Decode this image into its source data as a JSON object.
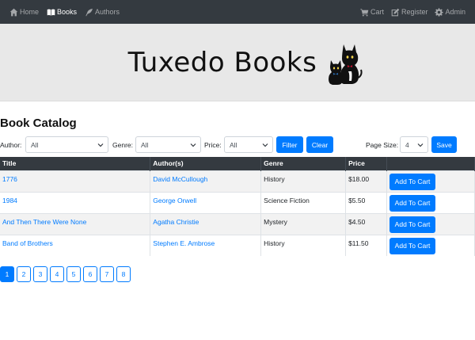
{
  "nav": {
    "left": [
      {
        "label": "Home",
        "icon": "home-icon"
      },
      {
        "label": "Books",
        "icon": "book-icon",
        "active": true
      },
      {
        "label": "Authors",
        "icon": "feather-icon"
      }
    ],
    "right": [
      {
        "label": "Cart",
        "icon": "cart-icon"
      },
      {
        "label": "Register",
        "icon": "edit-icon"
      },
      {
        "label": "Admin",
        "icon": "gear-icon"
      }
    ]
  },
  "banner": {
    "title": "Tuxedo Books"
  },
  "catalog": {
    "heading": "Book Catalog",
    "filters": {
      "author_label": "Author:",
      "author_value": "All",
      "genre_label": "Genre:",
      "genre_value": "All",
      "price_label": "Price:",
      "price_value": "All",
      "filter_button": "Filter",
      "clear_button": "Clear",
      "page_size_label": "Page Size:",
      "page_size_value": "4",
      "save_button": "Save"
    },
    "columns": [
      "Title",
      "Author(s)",
      "Genre",
      "Price",
      ""
    ],
    "rows": [
      {
        "title": "1776",
        "author": "David McCullough",
        "genre": "History",
        "price": "$18.00",
        "action": "Add To Cart"
      },
      {
        "title": "1984",
        "author": "George Orwell",
        "genre": "Science Fiction",
        "price": "$5.50",
        "action": "Add To Cart"
      },
      {
        "title": "And Then There Were None",
        "author": "Agatha Christie",
        "genre": "Mystery",
        "price": "$4.50",
        "action": "Add To Cart"
      },
      {
        "title": "Band of Brothers",
        "author": "Stephen E. Ambrose",
        "genre": "History",
        "price": "$11.50",
        "action": "Add To Cart"
      }
    ],
    "pages": [
      "1",
      "2",
      "3",
      "4",
      "5",
      "6",
      "7",
      "8"
    ],
    "current_page": "1"
  },
  "colors": {
    "navbar": "#343a40",
    "primary": "#007bff",
    "banner": "#e8e8e8"
  }
}
